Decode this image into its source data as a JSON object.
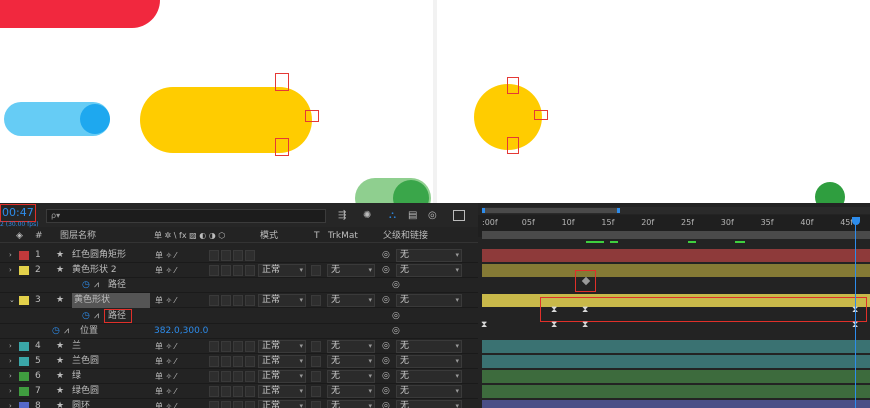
{
  "timecode": "00:47",
  "timecode_sub": "2 (30.00 fps)",
  "search_placeholder": "ρ▾",
  "headers": {
    "layer_name": "图层名称",
    "switches": "单 ✲ \\ fx ▨ ◐ ◑ ⬡",
    "mode": "模式",
    "t": "T",
    "trkmat": "TrkMat",
    "parent": "父级和链接"
  },
  "ruler_labels": [
    ":00f",
    "05f",
    "10f",
    "15f",
    "20f",
    "25f",
    "30f",
    "35f",
    "40f",
    "45f"
  ],
  "layers": [
    {
      "num": "1",
      "name": "红色圆角矩形",
      "color": "#c0393b",
      "mode": "",
      "trkmat": "",
      "parent": "无",
      "bar": "#8e3a3a"
    },
    {
      "num": "2",
      "name": "黄色形状 2",
      "color": "#e2d04a",
      "mode": "正常",
      "trkmat": "无",
      "parent": "无",
      "bar": "#857a35"
    },
    {
      "sub": true,
      "name": "路径"
    },
    {
      "num": "3",
      "name": "黄色形状",
      "color": "#e2d04a",
      "mode": "正常",
      "trkmat": "无",
      "parent": "无",
      "bar": "#c9b94a",
      "selected": true
    },
    {
      "sub": true,
      "name": "路径",
      "boxed": true
    },
    {
      "prop": true,
      "name": "位置",
      "value": "382.0,300.0"
    },
    {
      "num": "4",
      "name": "兰",
      "color": "#3aa6a8",
      "mode": "正常",
      "trkmat": "无",
      "parent": "无",
      "bar": "#3a7272"
    },
    {
      "num": "5",
      "name": "兰色圆",
      "color": "#3aa6a8",
      "mode": "正常",
      "trkmat": "无",
      "parent": "无",
      "bar": "#3a7272"
    },
    {
      "num": "6",
      "name": "绿",
      "color": "#3f9c3f",
      "mode": "正常",
      "trkmat": "无",
      "parent": "无",
      "bar": "#3d6b3d"
    },
    {
      "num": "7",
      "name": "绿色圆",
      "color": "#3f9c3f",
      "mode": "正常",
      "trkmat": "无",
      "parent": "无",
      "bar": "#3d6b3d"
    },
    {
      "num": "8",
      "name": "圆环",
      "color": "#5568c8",
      "mode": "正常",
      "trkmat": "无",
      "parent": "无",
      "bar": "#4a4f86"
    }
  ],
  "colors": {
    "accent": "#2d8ceb",
    "red_marker": "#e0302a",
    "yellow": "#ffcc00",
    "blue_light": "#66ccf5",
    "blue": "#1ea8ef",
    "green": "#3aa64a",
    "red": "#f1283e"
  }
}
